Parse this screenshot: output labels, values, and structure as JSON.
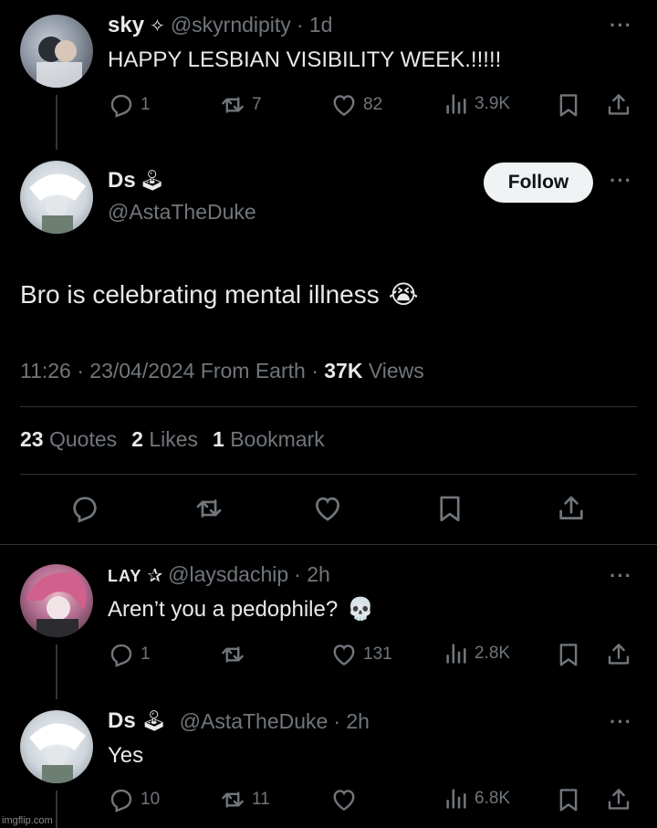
{
  "tweet1": {
    "name": "sky",
    "badge": "✧",
    "handle": "@skyrndipity",
    "time": "· 1d",
    "text": "HAPPY LESBIAN VISIBILITY WEEK.!!!!!",
    "replies": "1",
    "retweets": "7",
    "likes": "82",
    "views": "3.9K"
  },
  "main_tweet": {
    "name": "Ds",
    "emoji": "🕹",
    "handle": "@AstaTheDuke",
    "follow_label": "Follow",
    "text": "Bro is celebrating mental illness",
    "text_emoji": "😭",
    "meta_time": "11:26 · 23/04/2024 From Earth · ",
    "views_count": "37K",
    "views_label": " Views",
    "quotes_count": "23",
    "quotes_label": "Quotes",
    "likes_count": "2",
    "likes_label": "Likes",
    "bookmarks_count": "1",
    "bookmarks_label": "Bookmark"
  },
  "reply1": {
    "name": "LAY",
    "badge": "✰",
    "handle": "@laysdachip",
    "time": "· 2h",
    "text": "Aren’t you a pedophile?",
    "text_emoji": "💀",
    "replies": "1",
    "retweets": "",
    "likes": "131",
    "views": "2.8K"
  },
  "reply2": {
    "name": "Ds",
    "emoji": "🕹",
    "handle": "@AstaTheDuke",
    "time": "· 2h",
    "text": "Yes",
    "replies": "10",
    "retweets": "11",
    "likes": "",
    "views": "6.8K"
  },
  "more_glyph": "···",
  "watermark": "imgflip.com",
  "colors": {
    "background": "#000000",
    "text": "#e7e9ea",
    "muted": "#71767b",
    "divider": "#2f3336"
  }
}
